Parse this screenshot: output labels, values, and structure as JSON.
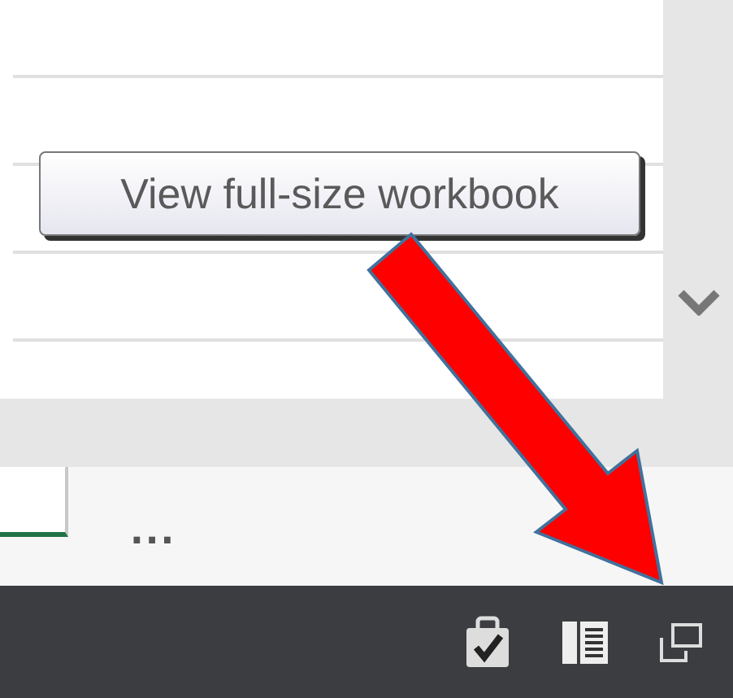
{
  "tooltip": {
    "text": "View full-size workbook"
  },
  "sheet_tabs": {
    "more": "..."
  },
  "status_bar": {
    "buttons": [
      {
        "kind": "checklist"
      },
      {
        "kind": "reading"
      },
      {
        "kind": "fullsize"
      }
    ]
  }
}
